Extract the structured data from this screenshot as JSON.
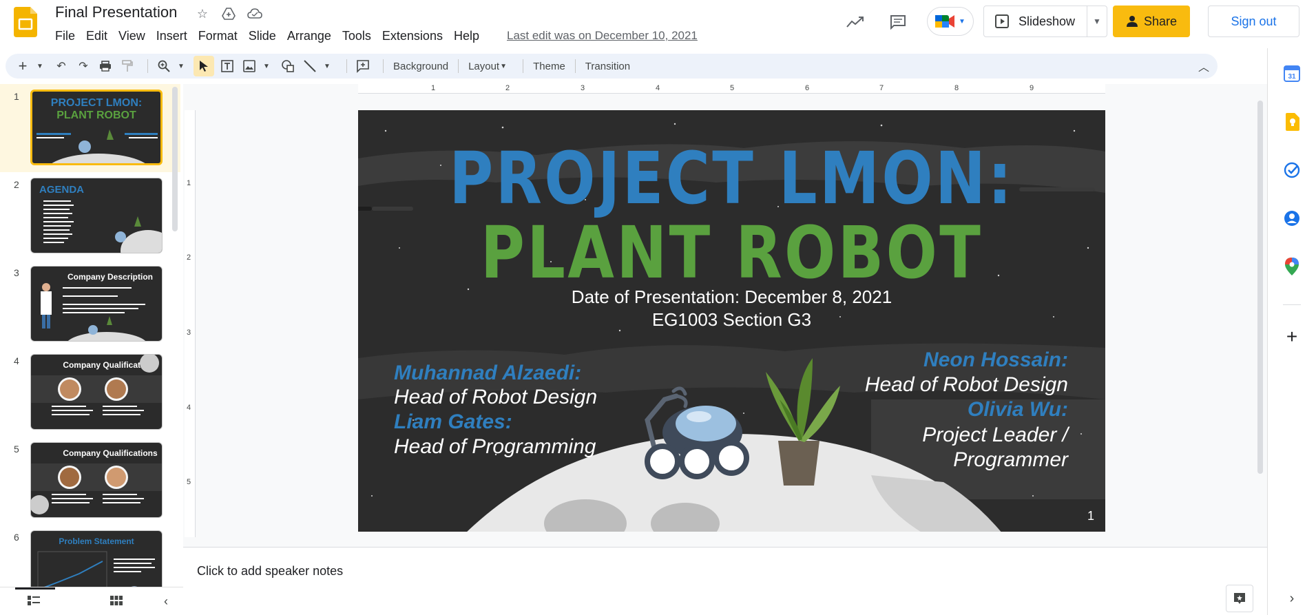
{
  "app": {
    "doc_title": "Final Presentation",
    "last_edit": "Last edit was on December 10, 2021",
    "menu": [
      "File",
      "Edit",
      "View",
      "Insert",
      "Format",
      "Slide",
      "Arrange",
      "Tools",
      "Extensions",
      "Help"
    ],
    "slideshow_label": "Slideshow",
    "share_label": "Share",
    "signout_label": "Sign out"
  },
  "toolbar": {
    "background_label": "Background",
    "layout_label": "Layout",
    "theme_label": "Theme",
    "transition_label": "Transition"
  },
  "ruler": {
    "h_ticks": [
      "1",
      "2",
      "3",
      "4",
      "5",
      "6",
      "7",
      "8",
      "9"
    ],
    "v_ticks": [
      "1",
      "2",
      "3",
      "4",
      "5"
    ]
  },
  "filmstrip": {
    "slides": [
      {
        "num": "1",
        "title": "PROJECT LMON:",
        "subtitle": "PLANT ROBOT"
      },
      {
        "num": "2",
        "title": "AGENDA",
        "subtitle": ""
      },
      {
        "num": "3",
        "title": "Company Description",
        "subtitle": ""
      },
      {
        "num": "4",
        "title": "Company Qualifications",
        "subtitle": ""
      },
      {
        "num": "5",
        "title": "Company Qualifications",
        "subtitle": ""
      },
      {
        "num": "6",
        "title": "Problem Statement",
        "subtitle": ""
      }
    ]
  },
  "slide": {
    "title_line1": "PROJECT LMON:",
    "title_line2": "PLANT ROBOT",
    "date_line": "Date of Presentation: December 8, 2021",
    "section_line": "EG1003 Section G3",
    "people_left": [
      {
        "name": "Muhannad Alzaedi:",
        "role": "Head of Robot Design"
      },
      {
        "name": "Liam Gates:",
        "role": "Head of Programming"
      }
    ],
    "people_right": [
      {
        "name": "Neon Hossain:",
        "role": "Head of Robot Design"
      },
      {
        "name": "Olivia Wu:",
        "role_line1": "Project Leader /",
        "role_line2": "Programmer"
      }
    ],
    "slide_number": "1"
  },
  "notes": {
    "placeholder": "Click to add speaker notes"
  },
  "colors": {
    "accent_yellow": "#f9bb0f",
    "title_blue": "#2f7fbf",
    "title_green": "#5aa13f",
    "slide_bg": "#2c2c2c"
  },
  "icons": {
    "header": [
      "star-icon",
      "move-to-drive-icon",
      "cloud-saved-icon",
      "activity-icon",
      "comment-icon",
      "meet-icon",
      "slideshow-play-icon",
      "lock-icon"
    ],
    "side": [
      "calendar-icon",
      "keep-icon",
      "tasks-icon",
      "contacts-icon",
      "maps-icon",
      "add-icon"
    ]
  }
}
